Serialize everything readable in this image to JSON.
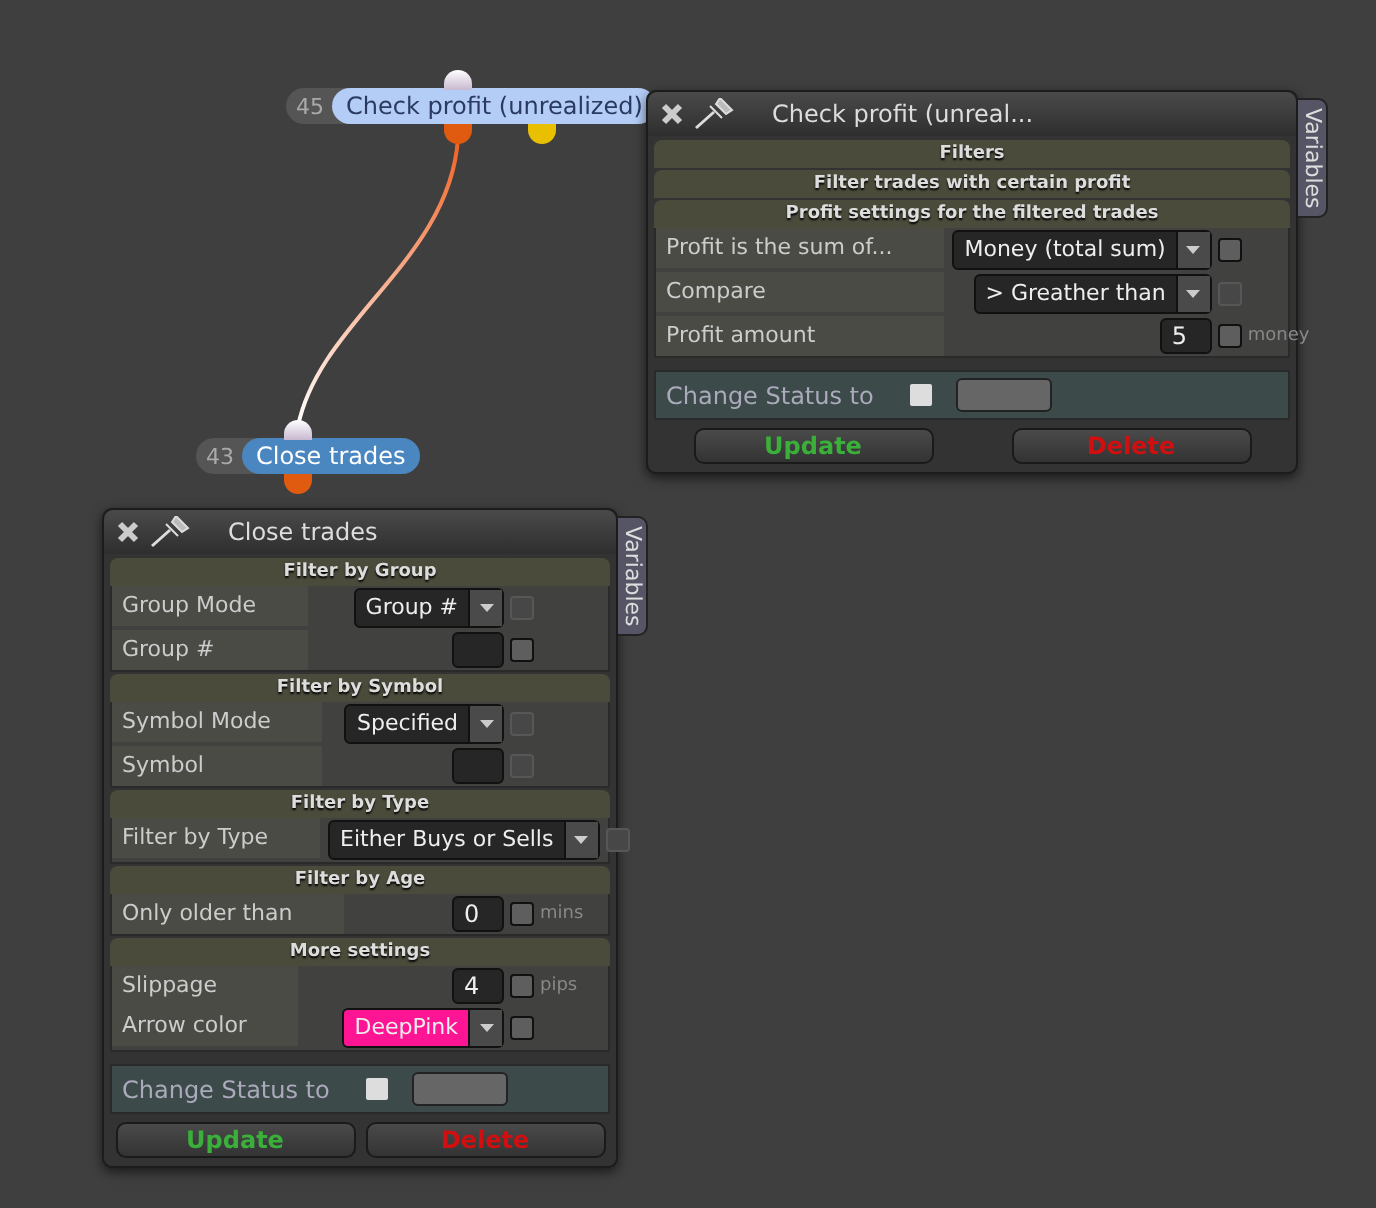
{
  "nodes": [
    {
      "number": "45",
      "label": "Check profit (unrealized)",
      "selected": true
    },
    {
      "number": "43",
      "label": "Close trades",
      "selected": false
    }
  ],
  "panels": [
    {
      "title": "Check profit (unreal...",
      "side_tab": "Variables",
      "sections": [
        {
          "title": "Filters"
        },
        {
          "title": "Filter trades with certain profit"
        },
        {
          "title": "Profit settings for the filtered trades",
          "rows": [
            {
              "label": "Profit is the sum of...",
              "kind": "dropdown",
              "value": "Money (total sum)",
              "checkbox": {
                "checked": false,
                "disabled": false
              }
            },
            {
              "label": "Compare",
              "kind": "dropdown",
              "value": "> Greather than",
              "checkbox": {
                "checked": false,
                "disabled": true
              }
            },
            {
              "label": "Profit amount",
              "kind": "number",
              "value": "5",
              "checkbox": {
                "checked": false,
                "disabled": false
              },
              "unit": "money"
            }
          ]
        }
      ],
      "status": {
        "label": "Change Status to",
        "checked": false
      },
      "buttons": [
        {
          "label": "Update",
          "kind": "update"
        },
        {
          "label": "Delete",
          "kind": "delete"
        }
      ]
    },
    {
      "title": "Close trades",
      "side_tab": "Variables",
      "sections": [
        {
          "title": "Filter by Group",
          "rows": [
            {
              "label": "Group Mode",
              "kind": "dropdown",
              "value": "Group #",
              "checkbox": {
                "checked": false,
                "disabled": true
              }
            },
            {
              "label": "Group #",
              "kind": "number",
              "value": "",
              "checkbox": {
                "checked": false,
                "disabled": false
              }
            }
          ]
        },
        {
          "title": "Filter by Symbol",
          "rows": [
            {
              "label": "Symbol Mode",
              "kind": "dropdown",
              "value": "Specified",
              "checkbox": {
                "checked": false,
                "disabled": true
              }
            },
            {
              "label": "Symbol",
              "kind": "number",
              "value": "",
              "checkbox": {
                "checked": false,
                "disabled": true
              }
            }
          ]
        },
        {
          "title": "Filter by Type",
          "rows": [
            {
              "label": "Filter by Type",
              "kind": "dropdown",
              "value": "Either Buys or Sells",
              "checkbox": {
                "checked": false,
                "disabled": true
              }
            }
          ]
        },
        {
          "title": "Filter by Age",
          "rows": [
            {
              "label": "Only older than",
              "kind": "number",
              "value": "0",
              "checkbox": {
                "checked": false,
                "disabled": false
              },
              "unit": "mins"
            }
          ]
        },
        {
          "title": "More settings",
          "rows": [
            {
              "label": "Slippage",
              "kind": "number",
              "value": "4",
              "checkbox": {
                "checked": false,
                "disabled": false
              },
              "unit": "pips"
            },
            {
              "label": "Arrow color",
              "kind": "color",
              "value": "DeepPink",
              "color": "#ff1493",
              "checkbox": {
                "checked": false,
                "disabled": false
              }
            }
          ]
        }
      ],
      "status": {
        "label": "Change Status to",
        "checked": false
      },
      "buttons": [
        {
          "label": "Update",
          "kind": "update"
        },
        {
          "label": "Delete",
          "kind": "delete"
        }
      ]
    }
  ]
}
